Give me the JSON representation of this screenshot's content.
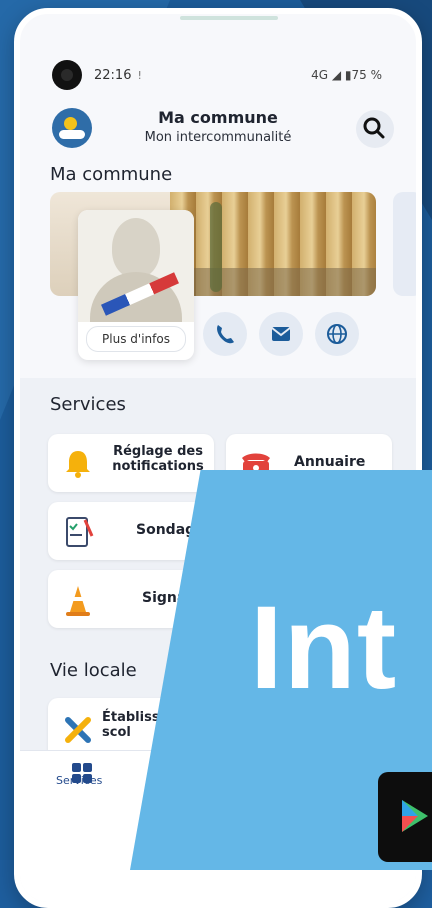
{
  "status_bar": {
    "time": "22:16",
    "right_indicators": "4G ◢ ▮75 %"
  },
  "header": {
    "title": "Ma commune",
    "subtitle": "Mon intercommunalité"
  },
  "commune": {
    "section_title": "Ma commune",
    "more_info_label": "Plus d'infos"
  },
  "services": {
    "section_title": "Services",
    "tiles": [
      {
        "label": "Réglage des\nnotifications",
        "icon": "bell-icon"
      },
      {
        "label": "Annuaire",
        "icon": "phone-directory-icon"
      },
      {
        "label": "Sondages",
        "icon": "clipboard-icon"
      },
      {
        "label": "Signale",
        "icon": "traffic-cone-icon"
      }
    ]
  },
  "vie_locale": {
    "section_title": "Vie locale",
    "tiles": [
      {
        "label": "Établiss\nscol",
        "icon": "tools-icon"
      }
    ]
  },
  "tab_bar": {
    "services_label": "Services"
  },
  "overlay": {
    "text": "Int"
  },
  "colors": {
    "accent": "#2f6da8",
    "overlay": "#64b7e7",
    "background": "#1e5e9e"
  }
}
